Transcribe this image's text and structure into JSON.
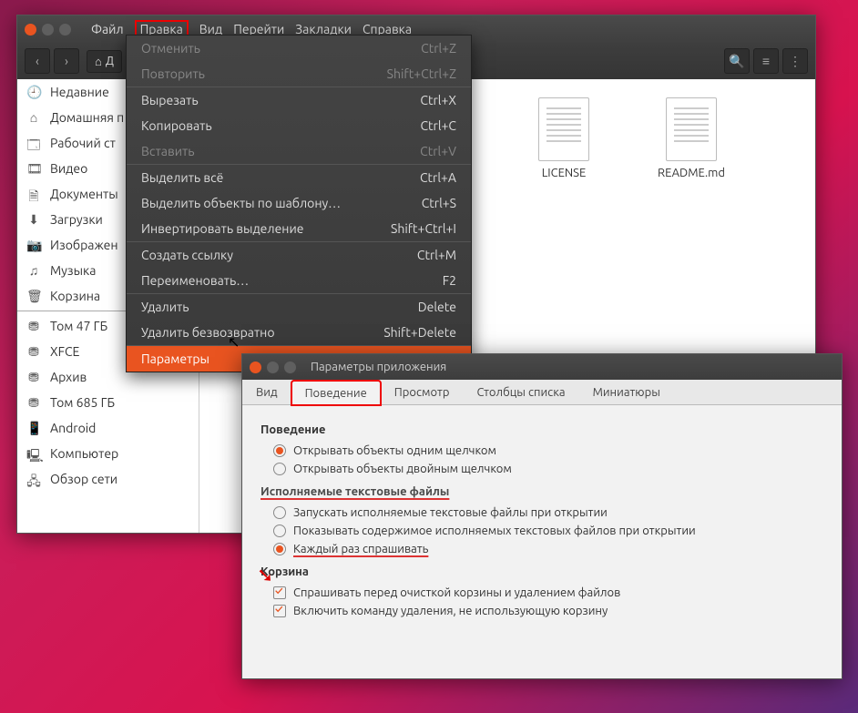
{
  "menubar": [
    "Файл",
    "Правка",
    "Вид",
    "Перейти",
    "Закладки",
    "Справка"
  ],
  "menubar_highlight": 1,
  "path_label": "Д",
  "toolbar_icons": {
    "back": "‹",
    "fwd": "›",
    "home": "⌂",
    "search": "🔍",
    "list": "≡",
    "grid": "⋮"
  },
  "sidebar": [
    {
      "icon": "🕘",
      "label": "Недавние"
    },
    {
      "icon": "⌂",
      "label": "Домашняя п"
    },
    {
      "icon": "🗔",
      "label": "Рабочий ст"
    },
    {
      "icon": "🎞",
      "label": "Видео"
    },
    {
      "icon": "🗎",
      "label": "Документы"
    },
    {
      "icon": "⬇",
      "label": "Загрузки"
    },
    {
      "icon": "📷",
      "label": "Изображен"
    },
    {
      "icon": "♫",
      "label": "Музыка"
    },
    {
      "icon": "🗑",
      "label": "Корзина"
    },
    {
      "sep": true
    },
    {
      "icon": "⛃",
      "label": "Том 47 ГБ"
    },
    {
      "icon": "⛃",
      "label": "XFCE"
    },
    {
      "icon": "⛃",
      "label": "Архив"
    },
    {
      "icon": "⛃",
      "label": "Том 685 ГБ"
    },
    {
      "icon": "📱",
      "label": "Android"
    },
    {
      "icon": "🖳",
      "label": "Компьютер"
    },
    {
      "icon": "🖧",
      "label": "Обзор сети"
    }
  ],
  "files": [
    {
      "name": "LICENSE"
    },
    {
      "name": "README.md"
    }
  ],
  "dropdown": [
    {
      "label": "Отменить",
      "accel": "Ctrl+Z",
      "disabled": true
    },
    {
      "label": "Повторить",
      "accel": "Shift+Ctrl+Z",
      "disabled": true
    },
    {
      "sep": true
    },
    {
      "label": "Вырезать",
      "accel": "Ctrl+X"
    },
    {
      "label": "Копировать",
      "accel": "Ctrl+C"
    },
    {
      "label": "Вставить",
      "accel": "Ctrl+V",
      "disabled": true
    },
    {
      "sep": true
    },
    {
      "label": "Выделить всё",
      "accel": "Ctrl+A"
    },
    {
      "label": "Выделить объекты по шаблону…",
      "accel": "Ctrl+S"
    },
    {
      "label": "Инвертировать выделение",
      "accel": "Shift+Ctrl+I"
    },
    {
      "sep": true
    },
    {
      "label": "Создать ссылку",
      "accel": "Ctrl+M"
    },
    {
      "label": "Переименовать…",
      "accel": "F2"
    },
    {
      "sep": true
    },
    {
      "label": "Удалить",
      "accel": "Delete"
    },
    {
      "label": "Удалить безвозвратно",
      "accel": "Shift+Delete"
    },
    {
      "sep": true
    },
    {
      "label": "Параметры",
      "accel": "",
      "active": true
    }
  ],
  "prefs": {
    "title": "Параметры приложения",
    "tabs": [
      "Вид",
      "Поведение",
      "Просмотр",
      "Столбцы списка",
      "Миниатюры"
    ],
    "active_tab": 1,
    "sections": {
      "behavior": {
        "heading": "Поведение",
        "opts": [
          {
            "type": "radio",
            "label": "Открывать объекты одним щелчком",
            "sel": true
          },
          {
            "type": "radio",
            "label": "Открывать объекты двойным щелчком",
            "sel": false
          }
        ]
      },
      "exec": {
        "heading": "Исполняемые текстовые файлы",
        "underline": true,
        "opts": [
          {
            "type": "radio",
            "label": "Запускать исполняемые текстовые файлы при открытии",
            "sel": false
          },
          {
            "type": "radio",
            "label": "Показывать содержимое исполняемых текстовых файлов при открытии",
            "sel": false
          },
          {
            "type": "radio",
            "label": "Каждый раз спрашивать",
            "sel": true,
            "underline": true
          }
        ]
      },
      "trash": {
        "heading": "Корзина",
        "opts": [
          {
            "type": "cb",
            "label": "Спрашивать перед очисткой корзины и удалением файлов",
            "sel": true
          },
          {
            "type": "cb",
            "label": "Включить команду удаления, не использующую корзину",
            "sel": true
          }
        ]
      }
    }
  }
}
